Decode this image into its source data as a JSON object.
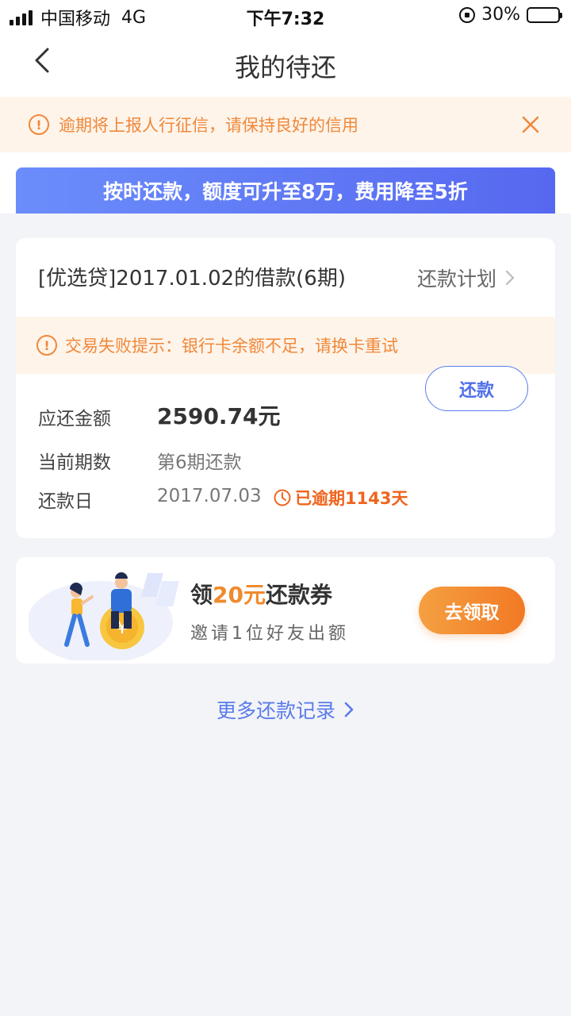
{
  "status_bar": {
    "carrier": "中国移动",
    "network": "4G",
    "time": "下午7:32",
    "battery_percent": "30%",
    "battery_level": 0.3
  },
  "nav": {
    "title": "我的待还",
    "back_icon": "chevron-left-icon"
  },
  "notice": {
    "text": "逾期将上报人行征信，请保持良好的信用",
    "icon": "info-icon",
    "close_icon": "close-icon"
  },
  "promo_banner": {
    "text": "按时还款，额度可升至8万，费用降至5折"
  },
  "loan": {
    "title": "[优选贷]2017.01.02的借款(6期)",
    "plan_link": "还款计划",
    "fail_notice": "交易失败提示：银行卡余额不足，请换卡重试",
    "repay_button": "还款",
    "amount_label": "应还金额",
    "amount_value": "2590.74元",
    "period_label": "当前期数",
    "period_value": "第6期还款",
    "due_label": "还款日",
    "due_value": "2017.07.03",
    "overdue_text": "已逾期1143天"
  },
  "coupon": {
    "title_prefix": "领",
    "title_amount": "20元",
    "title_suffix": "还款券",
    "subtitle": "邀请1位好友出额",
    "claim_button": "去领取"
  },
  "more_records": {
    "text": "更多还款记录"
  },
  "colors": {
    "accent_blue": "#5668ef",
    "warning_orange": "#f0883a",
    "overdue_red": "#f0641e",
    "claim_orange": "#f27924"
  }
}
